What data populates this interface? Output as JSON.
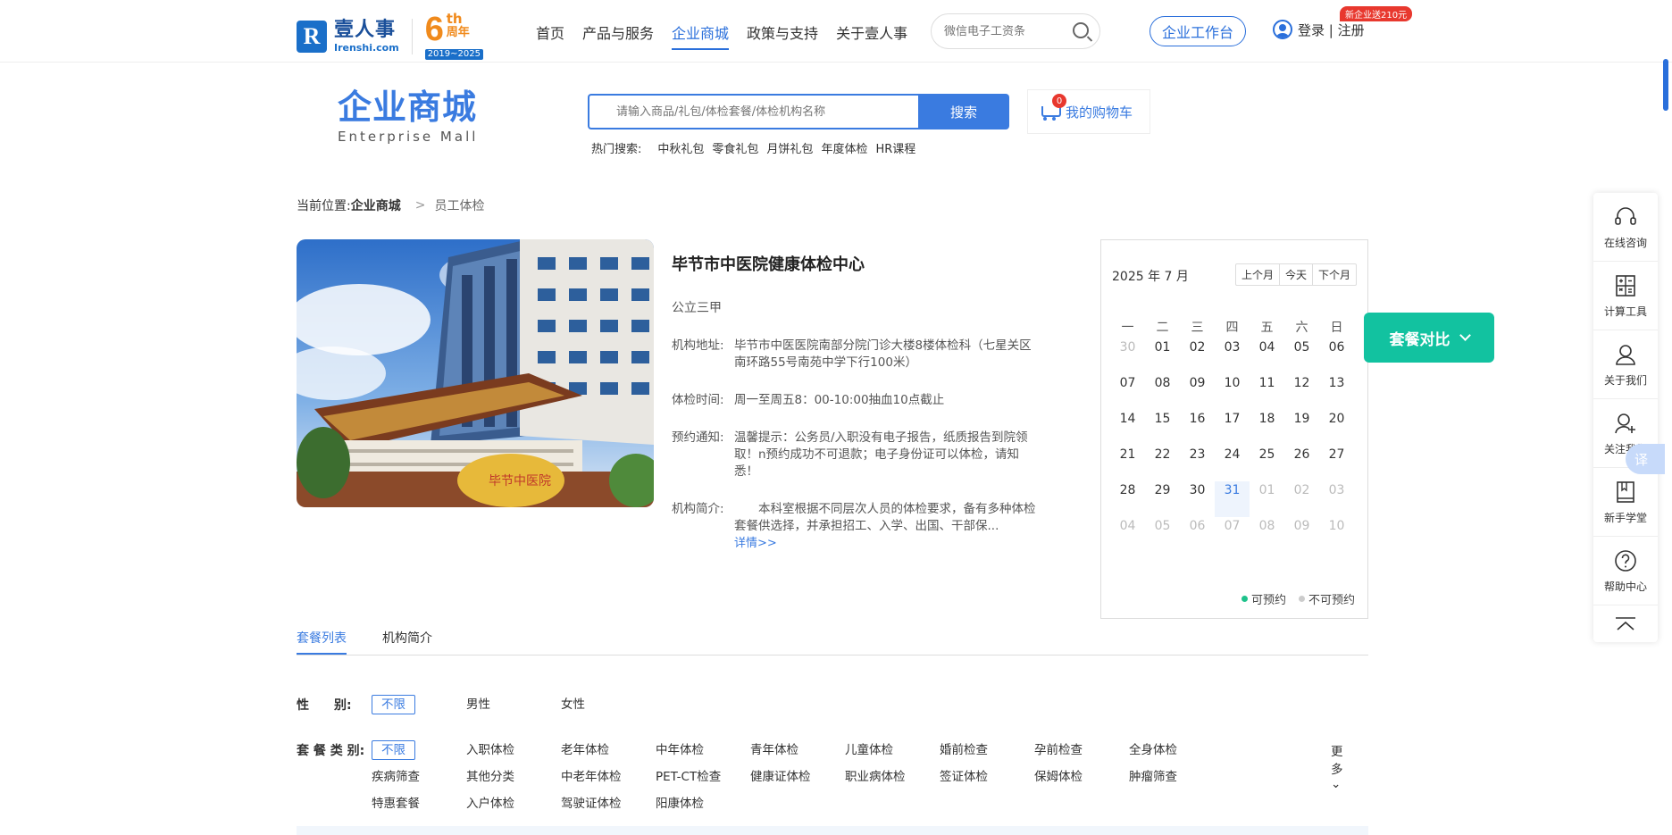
{
  "header": {
    "logo_cn": "壹人事",
    "logo_en": "Irenshi.com",
    "anniv_num": "6",
    "anniv_th": "th",
    "anniv_zn": "周年",
    "anniv_years": "2019~2025",
    "nav": [
      "首页",
      "产品与服务",
      "企业商城",
      "政策与支持",
      "关于壹人事"
    ],
    "search_placeholder": "微信电子工资条",
    "workbench": "企业工作台",
    "login": "登录 | 注册",
    "promo": "新企业送210元"
  },
  "mall": {
    "title_cn": "企业商城",
    "title_en": "Enterprise  Mall",
    "search_placeholder": "请输入商品/礼包/体检套餐/体检机构名称",
    "search_button": "搜索",
    "hot_label": "热门搜索:",
    "hot": [
      "中秋礼包",
      "零食礼包",
      "月饼礼包",
      "年度体检",
      "HR课程"
    ],
    "cart_label": "我的购物车",
    "cart_count": "0"
  },
  "breadcrumb": {
    "label": "当前位置:",
    "level1": "企业商城",
    "arrow": ">",
    "level2": "员工体检"
  },
  "institution": {
    "name": "毕节市中医院健康体检中心",
    "grade": "公立三甲",
    "address_k": "机构地址:",
    "address_v": "毕节市中医医院南部分院门诊大楼8楼体检科（七星关区南环路55号南苑中学下行100米）",
    "time_k": "体检时间:",
    "time_v": "周一至周五8：00-10:00抽血10点截止",
    "notice_k": "预约通知:",
    "notice_v": "温馨提示：公务员/入职没有电子报告，纸质报告到院领取！n预约成功不可退款；电子身份证可以体检，请知悉！",
    "intro_k": "机构简介:",
    "intro_v": "本科室根据不同层次人员的体检要求，备有多种体检套餐供选择，并承担招工、入学、出国、干部保...",
    "more": "详情>>"
  },
  "calendar": {
    "title": "2025 年 7 月",
    "prev": "上个月",
    "today": "今天",
    "next": "下个月",
    "weekdays": [
      "一",
      "二",
      "三",
      "四",
      "五",
      "六",
      "日"
    ],
    "weeks": [
      [
        [
          "30",
          "out"
        ],
        [
          "01",
          "in"
        ],
        [
          "02",
          "in"
        ],
        [
          "03",
          "in"
        ],
        [
          "04",
          "in"
        ],
        [
          "05",
          "in"
        ],
        [
          "06",
          "in"
        ]
      ],
      [
        [
          "07",
          "in"
        ],
        [
          "08",
          "in"
        ],
        [
          "09",
          "in"
        ],
        [
          "10",
          "in"
        ],
        [
          "11",
          "in"
        ],
        [
          "12",
          "in"
        ],
        [
          "13",
          "in"
        ]
      ],
      [
        [
          "14",
          "in"
        ],
        [
          "15",
          "in"
        ],
        [
          "16",
          "in"
        ],
        [
          "17",
          "in"
        ],
        [
          "18",
          "in"
        ],
        [
          "19",
          "in"
        ],
        [
          "20",
          "in"
        ]
      ],
      [
        [
          "21",
          "in"
        ],
        [
          "22",
          "in"
        ],
        [
          "23",
          "in"
        ],
        [
          "24",
          "in"
        ],
        [
          "25",
          "in"
        ],
        [
          "26",
          "in"
        ],
        [
          "27",
          "in"
        ]
      ],
      [
        [
          "28",
          "in"
        ],
        [
          "29",
          "in"
        ],
        [
          "30",
          "in"
        ],
        [
          "31",
          "today"
        ],
        [
          "01",
          "out"
        ],
        [
          "02",
          "out"
        ],
        [
          "03",
          "out"
        ]
      ],
      [
        [
          "04",
          "out"
        ],
        [
          "05",
          "out"
        ],
        [
          "06",
          "out"
        ],
        [
          "07",
          "out"
        ],
        [
          "08",
          "out"
        ],
        [
          "09",
          "out"
        ],
        [
          "10",
          "out"
        ]
      ]
    ],
    "legend_available": "可预约",
    "legend_unavailable": "不可预约",
    "color_available": "#1ec28b",
    "color_unavailable": "#cccccc"
  },
  "compare_button": "套餐对比",
  "sidebar": [
    {
      "label": "在线咨询",
      "icon": "headset-icon"
    },
    {
      "label": "计算工具",
      "icon": "calculator-icon"
    },
    {
      "label": "关于我们",
      "icon": "person-icon"
    },
    {
      "label": "关注我们",
      "icon": "add-user-icon"
    },
    {
      "label": "新手学堂",
      "icon": "book-icon"
    },
    {
      "label": "帮助中心",
      "icon": "help-icon"
    }
  ],
  "translate": "译",
  "tabs": [
    "套餐列表",
    "机构简介"
  ],
  "filters": {
    "gender_label": "性　　别:",
    "gender": [
      "不限",
      "男性",
      "女性"
    ],
    "type_label": "套 餐 类 别:",
    "types": [
      "不限",
      "入职体检",
      "老年体检",
      "中年体检",
      "青年体检",
      "儿童体检",
      "婚前检查",
      "孕前检查",
      "全身体检",
      "疾病筛查",
      "其他分类",
      "中老年体检",
      "PET-CT检查",
      "健康证体检",
      "职业病体检",
      "签证体检",
      "保姆体检",
      "肿瘤筛查",
      "特惠套餐",
      "入户体检",
      "驾驶证体检",
      "阳康体检"
    ],
    "more": "更多"
  }
}
